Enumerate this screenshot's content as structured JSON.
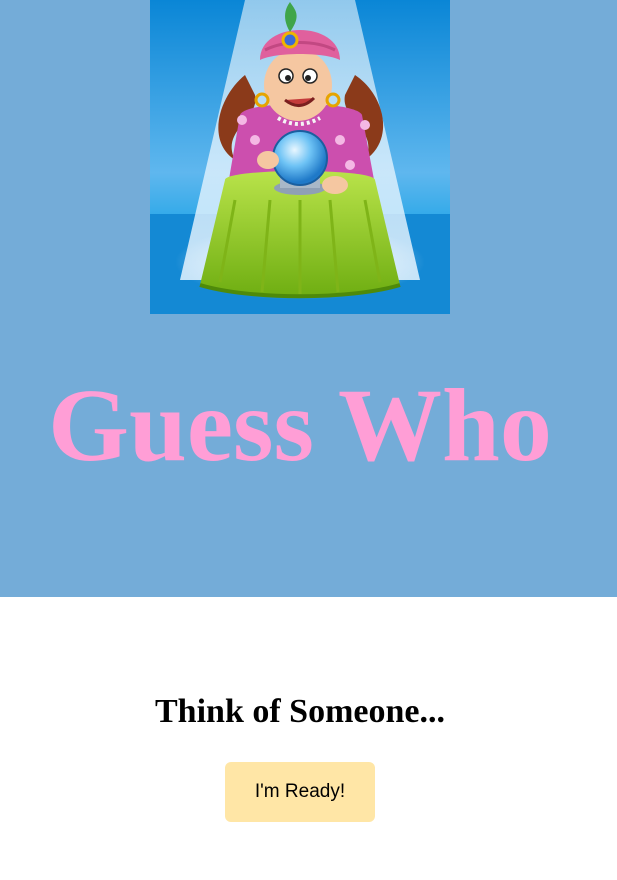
{
  "hero": {
    "title": "Guess Who",
    "illustration": "fortune-teller-with-crystal-ball"
  },
  "main": {
    "prompt": "Think of Someone...",
    "ready_button_label": "I'm Ready!"
  },
  "colors": {
    "hero_background": "#74acd8",
    "title": "#ff9ed6",
    "button_background": "#ffe6a6"
  }
}
